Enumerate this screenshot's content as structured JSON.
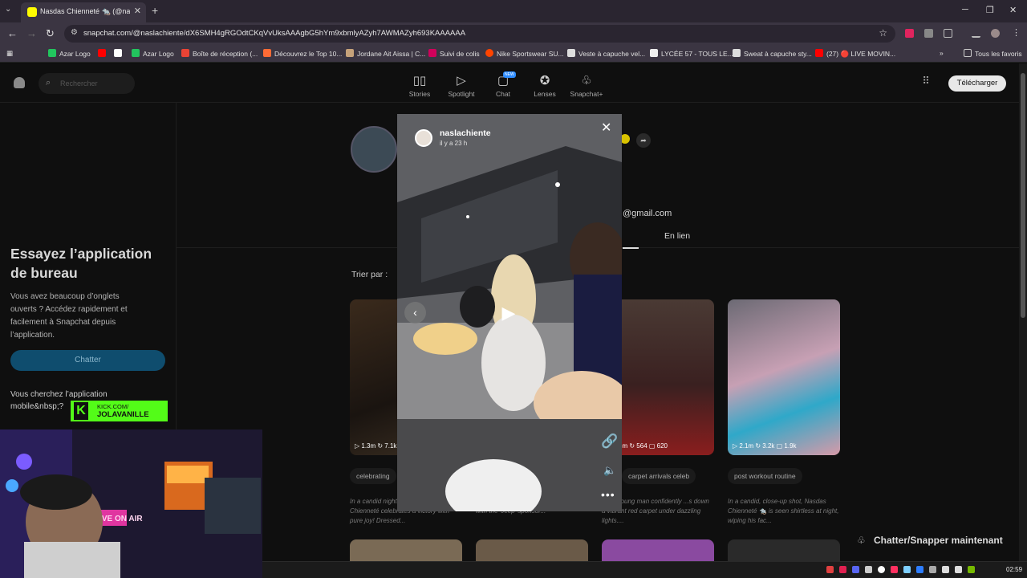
{
  "browser": {
    "tab_title": "Nasdas Chienneté 🐀 (@naslac",
    "url": "snapchat.com/@naslachiente/dX6SMH4gRGOdtCKqVvUksAAAgbG5hYm9xbmlyAZyh7AWMAZyh693KAAAAAA",
    "bookmarks": [
      {
        "label": "Azar Logo",
        "color": "#22c55e"
      },
      {
        "label": "",
        "color": "#ff0000"
      },
      {
        "label": "",
        "color": "#ffffff"
      },
      {
        "label": "Azar Logo",
        "color": "#22c55e"
      },
      {
        "label": "Boîte de réception (...",
        "color": "#ea4335"
      },
      {
        "label": "Découvrez le Top 10...",
        "color": "#ff6b35"
      },
      {
        "label": "Jordane Ait Aissa | C...",
        "color": "#c6a27a"
      },
      {
        "label": "Suivi de colis",
        "color": "#d1005b"
      },
      {
        "label": "Nike Sportswear SU...",
        "color": "#ff4400"
      },
      {
        "label": "Veste à capuche vel...",
        "color": "#dddddd"
      },
      {
        "label": "LYCÉE 57 - TOUS LE...",
        "color": "#eeeeee"
      },
      {
        "label": "Sweat à capuche sty...",
        "color": "#dddddd"
      },
      {
        "label": "(27) 🔴 LIVE MOVIN...",
        "color": "#ff0000"
      }
    ],
    "all_favorites": "Tous les favoris"
  },
  "snap": {
    "search_placeholder": "Rechercher",
    "nav": [
      {
        "label": "Stories",
        "icon": "▯▯"
      },
      {
        "label": "Spotlight",
        "icon": "▷"
      },
      {
        "label": "Chat",
        "icon": "▢"
      },
      {
        "label": "Lenses",
        "icon": "✪"
      },
      {
        "label": "Snapchat+",
        "icon": "♧"
      }
    ],
    "new_badge": "NEW",
    "download_label": "Télécharger",
    "promo_title": "Essayez l’application de bureau",
    "promo_body": "Vous avez beaucoup d’onglets ouverts ? Accédez rapidement et facilement à Snapchat depuis l’application.",
    "chat_button": "Chatter",
    "mobile_text": "Vous cherchez l’application mobile&nbsp;?",
    "email_fragment": "@gmail.com",
    "tab_link": "En lien",
    "sort_label": "Trier par :",
    "cards": [
      {
        "stats": "▷ 1.3m  ↻ 7.1k",
        "chip": "celebrating",
        "desc": "In a candid nighttime scene, Nasdas Chienneté celebrates a victory with pure joy! Dressed..."
      },
      {
        "stats": "",
        "chip": "",
        "desc": "...by a man in a black Adidas jersey with the 'Jeep' sponsor..."
      },
      {
        "stats": "▷ ...5m  ↻ 564  ▢ 620",
        "chip": "carpet arrivals   celeb",
        "desc": "...s a young man confidently ...s down a vibrant red carpet under dazzling lights...."
      },
      {
        "stats": "▷ 2.1m  ↻ 3.2k  ▢ 1.9k",
        "chip": "post workout routine",
        "desc": "In a candid, close-up shot, Nasdas Chienneté 🐀 is seen shirtless at night, wiping his fac..."
      }
    ],
    "cta_label": "Chatter/Snapper maintenant"
  },
  "modal": {
    "username": "naslachiente",
    "time": "il y a 23 h"
  },
  "stream": {
    "kick_line1": "KICK.COM/",
    "kick_line2": "JOLAVANILLE",
    "neon": "LIVE ON AIR"
  },
  "taskbar": {
    "clock": "02:59"
  }
}
